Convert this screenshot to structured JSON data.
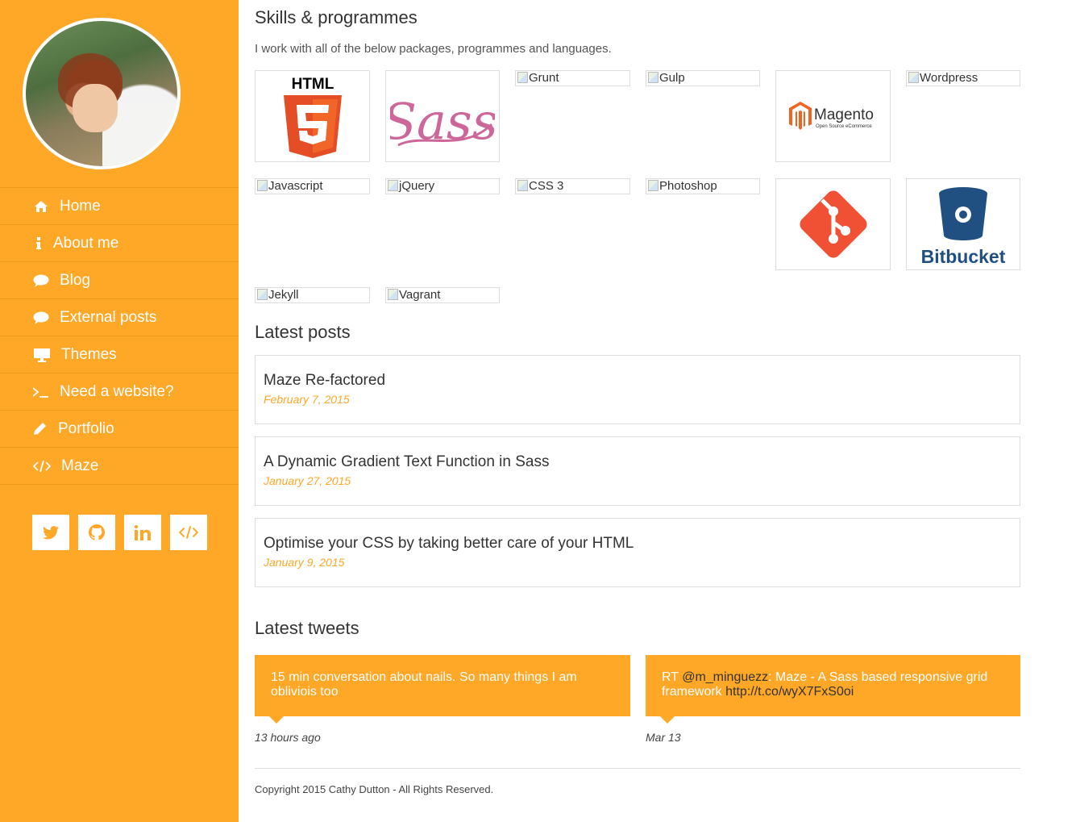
{
  "sidebar": {
    "avatar_alt": "Cathy Dutton",
    "nav": [
      {
        "label": "Home",
        "icon": "home-icon"
      },
      {
        "label": "About me",
        "icon": "info-icon"
      },
      {
        "label": "Blog",
        "icon": "comment-icon"
      },
      {
        "label": "External posts",
        "icon": "comment-icon"
      },
      {
        "label": "Themes",
        "icon": "desktop-icon"
      },
      {
        "label": "Need a website?",
        "icon": "terminal-icon"
      },
      {
        "label": "Portfolio",
        "icon": "pencil-icon"
      },
      {
        "label": "Maze",
        "icon": "code-icon"
      }
    ],
    "social": [
      "twitter-icon",
      "github-icon",
      "linkedin-icon",
      "code-icon"
    ]
  },
  "skills": {
    "title": "Skills & programmes",
    "description": "I work with all of the below packages, programmes and languages.",
    "items": [
      {
        "name": "HTML",
        "type": "logo"
      },
      {
        "name": "Sass",
        "type": "logo"
      },
      {
        "name": "Grunt",
        "type": "broken"
      },
      {
        "name": "Gulp",
        "type": "broken"
      },
      {
        "name": "Magento",
        "type": "logo",
        "subtitle": "Open Source eCommerce"
      },
      {
        "name": "Wordpress",
        "type": "broken"
      },
      {
        "name": "Javascript",
        "type": "broken"
      },
      {
        "name": "jQuery",
        "type": "broken"
      },
      {
        "name": "CSS 3",
        "type": "broken"
      },
      {
        "name": "Photoshop",
        "type": "broken"
      },
      {
        "name": "Git",
        "type": "logo"
      },
      {
        "name": "Bitbucket",
        "type": "logo"
      },
      {
        "name": "Jekyll",
        "type": "broken"
      },
      {
        "name": "Vagrant",
        "type": "broken"
      }
    ]
  },
  "posts": {
    "title": "Latest posts",
    "items": [
      {
        "title": "Maze Re-factored",
        "date": "February 7, 2015"
      },
      {
        "title": "A Dynamic Gradient Text Function in Sass",
        "date": "January 27, 2015"
      },
      {
        "title": "Optimise your CSS by taking better care of your HTML",
        "date": "January 9, 2015"
      }
    ]
  },
  "tweets": {
    "title": "Latest tweets",
    "items": [
      {
        "text": "15 min conversation about nails. So many things I am obliviois too",
        "time": "13 hours ago"
      },
      {
        "prefix": "RT ",
        "mention": "@m_minguezz",
        "text": ": Maze - A Sass based responsive grid framework ",
        "link": "http://t.co/wyX7FxS0oi",
        "time": "Mar 13"
      }
    ]
  },
  "footer": {
    "copyright": "Copyright 2015 Cathy Dutton - All Rights Reserved."
  },
  "colors": {
    "accent": "#ffa726",
    "html5": "#e44d26",
    "sass": "#cd6799",
    "magento": "#f26322",
    "git": "#f05033",
    "bitbucket": "#205081"
  }
}
